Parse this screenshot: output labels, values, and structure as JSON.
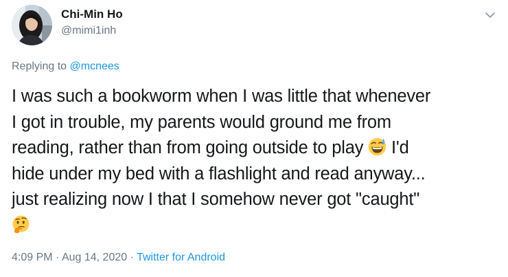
{
  "author": {
    "name": "Chi-Min Ho",
    "handle": "@mimi1inh"
  },
  "reply": {
    "prefix": "Replying to ",
    "mention": "@mcnees"
  },
  "body": {
    "line1": "I was such a bookworm when I was little that whenever",
    "line2": "I got in trouble, my parents would ground me from",
    "line3a": "reading, rather than from going outside to play ",
    "line3_emoji": "grinning-sweat-emoji",
    "line3b": " I'd",
    "line4": "hide under my bed with a flashlight and read anyway...",
    "line5": "just realizing now I that I somehow never got \"caught\"",
    "line6_emoji": "thinking-face-emoji"
  },
  "meta": {
    "time": "4:09 PM",
    "sep1": " · ",
    "date": "Aug 14, 2020",
    "sep2": " · ",
    "source": "Twitter for Android"
  },
  "icons": {
    "menu": "chevron-down-icon"
  },
  "colors": {
    "text": "#14171a",
    "secondary": "#657786",
    "link": "#1b95e0",
    "background": "#ffffff"
  }
}
